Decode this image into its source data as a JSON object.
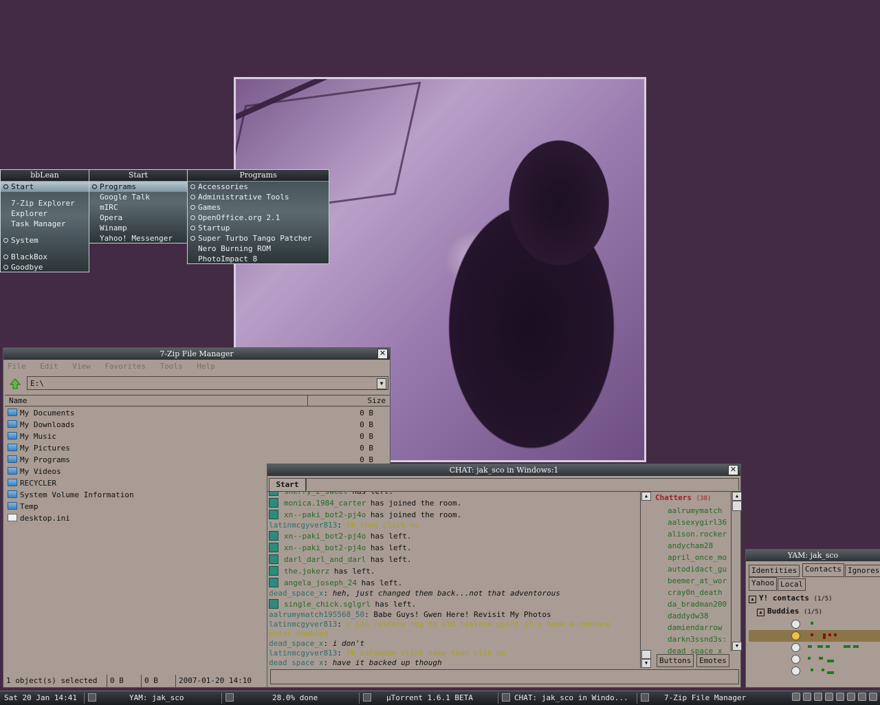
{
  "menus": {
    "bblean": {
      "title": "bbLean",
      "items": [
        "Start",
        "7-Zip Explorer",
        "Explorer",
        "Task Manager",
        "System",
        "BlackBox",
        "Goodbye"
      ]
    },
    "start": {
      "title": "Start",
      "items": [
        "Programs",
        "Google Talk",
        "mIRC",
        "Opera",
        "Winamp",
        "Yahoo! Messenger"
      ]
    },
    "programs": {
      "title": "Programs",
      "items": [
        "Accessories",
        "Administrative Tools",
        "Games",
        "OpenOffice.org 2.1",
        "Startup",
        "Super Turbo Tango Patcher",
        "Nero Burning ROM",
        "PhotoImpact 8"
      ]
    }
  },
  "zip": {
    "title": "7-Zip File Manager",
    "menu": [
      "File",
      "Edit",
      "View",
      "Favorites",
      "Tools",
      "Help"
    ],
    "address": "E:\\",
    "columns": {
      "name": "Name",
      "size": "Size"
    },
    "rows": [
      {
        "name": "My Documents",
        "size": "0 B",
        "icon": "folder-icon"
      },
      {
        "name": "My Downloads",
        "size": "0 B",
        "icon": "folder-icon"
      },
      {
        "name": "My Music",
        "size": "0 B",
        "icon": "folder-icon"
      },
      {
        "name": "My Pictures",
        "size": "0 B",
        "icon": "folder-icon"
      },
      {
        "name": "My Programs",
        "size": "0 B",
        "icon": "folder-icon"
      },
      {
        "name": "My Videos",
        "size": "",
        "icon": "folder-icon"
      },
      {
        "name": "RECYCLER",
        "size": "",
        "icon": "folder-icon"
      },
      {
        "name": "System Volume Information",
        "size": "",
        "icon": "folder-icon"
      },
      {
        "name": "Temp",
        "size": "",
        "icon": "folder-icon"
      },
      {
        "name": "desktop.ini",
        "size": "",
        "icon": "file-icon"
      }
    ],
    "status": {
      "selected": "1 object(s) selected",
      "size1": "0 B",
      "size2": "0 B",
      "modified": "2007-01-20 14:10"
    }
  },
  "chat": {
    "title": "CHAT: jak_sco in Windows:1",
    "tab": "Start",
    "lines": [
      {
        "kind": "sys",
        "user": "sherry_z_sweet",
        "text": " has left.",
        "ucls": "u-green"
      },
      {
        "kind": "sys",
        "user": "monica.1984_carter",
        "text": " has joined the room.",
        "ucls": "u-green"
      },
      {
        "kind": "sys",
        "user": "xn--paki_bot2-pj4o",
        "text": " has joined the room.",
        "ucls": "u-green"
      },
      {
        "kind": "msg",
        "user": "latinmcgyver813",
        "text": "f8 then click no",
        "ucls": "u-teal",
        "tcls": "u-yellow"
      },
      {
        "kind": "sys",
        "user": "xn--paki_bot2-pj4o",
        "text": " has left.",
        "ucls": "u-green"
      },
      {
        "kind": "sys",
        "user": "xn--paki_bot2-pj4o",
        "text": " has left.",
        "ucls": "u-green"
      },
      {
        "kind": "sys",
        "user": "darl_darl_and_darl",
        "text": " has left.",
        "ucls": "u-green"
      },
      {
        "kind": "sys",
        "user": "the.jokerz",
        "text": " has left.",
        "ucls": "u-green"
      },
      {
        "kind": "sys",
        "user": "angela_joseph_24",
        "text": " has left.",
        "ucls": "u-green"
      },
      {
        "kind": "msg",
        "user": "dead_space_x",
        "text": "heh, just changed them back...not that adventorous",
        "ucls": "u-teal",
        "tcls": "u-dark u-ital"
      },
      {
        "kind": "sys",
        "user": "single_chick.sglgrl",
        "text": " has left.",
        "ucls": "u-green"
      },
      {
        "kind": "msg",
        "user": "aalrumymatch195568_50",
        "text": "Babe Guys! Gwen Here! Revisit My Photos",
        "ucls": "u-teal",
        "tcls": "u-dark"
      },
      {
        "kind": "msg",
        "user": "latinmcgyver813",
        "text": "u can restore reg to old restore point  if u have a restore",
        "ucls": "u-teal",
        "tcls": "u-yellow"
      },
      {
        "kind": "cont",
        "text": "point enabled",
        "tcls": "u-yellow"
      },
      {
        "kind": "msg",
        "user": "dead_space_x",
        "text": "i don't",
        "ucls": "u-teal",
        "tcls": "u-dark u-ital"
      },
      {
        "kind": "msg",
        "user": "latinmcgyver813",
        "text": "f8   safemode   click name  then clik no",
        "ucls": "u-teal",
        "tcls": "u-yellow"
      },
      {
        "kind": "msg",
        "user": "dead_space_x",
        "text": "have it backed up though",
        "ucls": "u-teal",
        "tcls": "u-dark u-ital"
      }
    ],
    "chatters_label": "Chatters",
    "chatters_count": "(38)",
    "chatters": [
      "aalrumymatch",
      "aalsexygirl36",
      "alison.rocker",
      "andycham28",
      "april_once_mo",
      "autodidact_gu",
      "beemer_at_wor",
      "cray0n_death",
      "da_bradman200",
      "daddydw38",
      "damiendarrow",
      "darkn3ssnd3s:",
      "dead_space_x"
    ],
    "bottom_tabs": [
      "Buttons",
      "Emotes"
    ]
  },
  "yam": {
    "title": "YAM: jak_sco",
    "tabs": [
      "Identities",
      "Contacts",
      "Ignores"
    ],
    "subtabs": [
      "Yahoo",
      "Local"
    ],
    "contacts_label": "Y! contacts",
    "contacts_count": "(1/5)",
    "group_label": "Buddies",
    "group_count": "(1/5)"
  },
  "taskbar": {
    "clock": "Sat 20 Jan 14:41",
    "tasks": [
      "YAM: jak_sco",
      "28.0% done",
      "µTorrent 1.6.1 BETA",
      "CHAT: jak_sco in Windo...",
      "7-Zip File Manager"
    ]
  },
  "colors": {
    "desktop": "#432a45",
    "window_bg": "#a89c94",
    "chat_user": "#2d6e6e",
    "chat_join": "#256b25",
    "chat_highlight": "#a8a020",
    "chatters_header": "#9c2020"
  }
}
